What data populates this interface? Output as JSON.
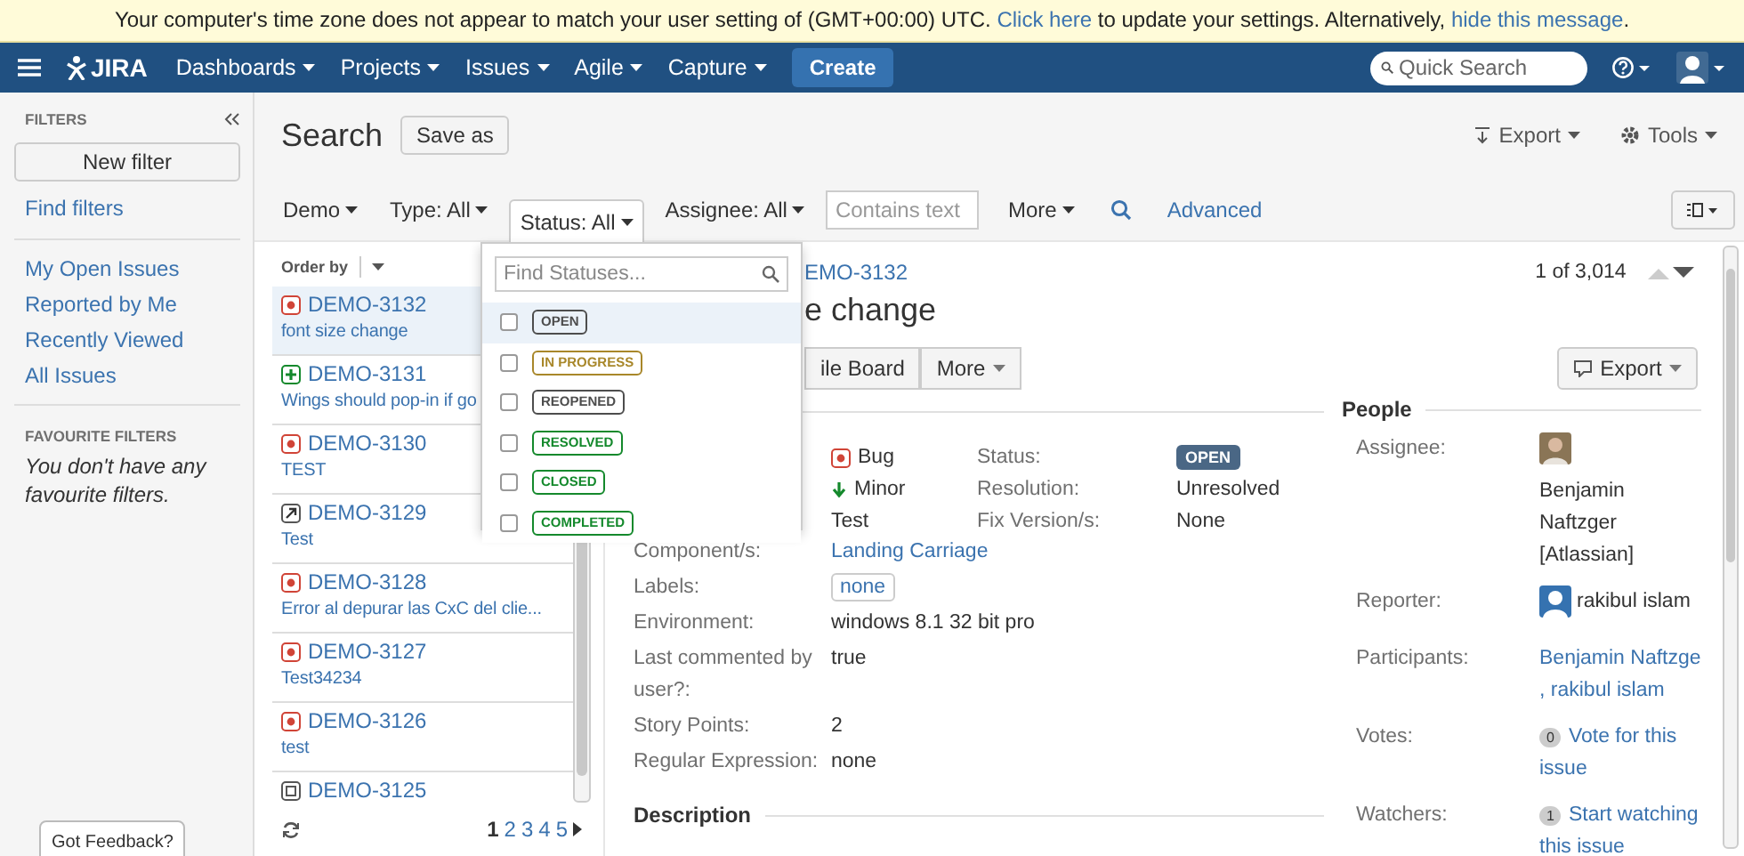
{
  "banner": {
    "parts": [
      {
        "kind": "text",
        "text": "Your computer's time zone does not appear to match your user setting of (GMT+00:00) UTC. "
      },
      {
        "kind": "link",
        "text": "Click here"
      },
      {
        "kind": "text",
        "text": " to update your settings. Alternatively, "
      },
      {
        "kind": "link",
        "text": "hide this message"
      },
      {
        "kind": "text",
        "text": "."
      }
    ]
  },
  "nav": {
    "logo": "JIRA",
    "menus": [
      "Dashboards",
      "Projects",
      "Issues",
      "Agile",
      "Capture"
    ],
    "create": "Create",
    "search_placeholder": "Quick Search"
  },
  "sidebar": {
    "title": "FILTERS",
    "new_filter": "New filter",
    "find_filters": "Find filters",
    "links": [
      "My Open Issues",
      "Reported by Me",
      "Recently Viewed",
      "All Issues"
    ],
    "favourites_title": "FAVOURITE FILTERS",
    "favourites_empty": "You don't have any favourite filters.",
    "feedback": "Got Feedback?"
  },
  "header": {
    "title": "Search",
    "save_as": "Save as",
    "export": "Export",
    "tools": "Tools"
  },
  "filters": [
    {
      "label": "Demo",
      "selected": false
    },
    {
      "label": "Type: All",
      "selected": false
    },
    {
      "label": "Status: All",
      "selected": true
    },
    {
      "label": "Assignee: All",
      "selected": false
    }
  ],
  "text_search": {
    "placeholder": "Contains text"
  },
  "more": "More",
  "advanced": "Advanced",
  "order_by": "Order by",
  "issues": [
    {
      "kind": "bug",
      "key": "DEMO-3132",
      "summary": "font size change",
      "selected": true
    },
    {
      "kind": "new-feature",
      "key": "DEMO-3131",
      "summary": "Wings should pop-in if go",
      "selected": false
    },
    {
      "kind": "bug",
      "key": "DEMO-3130",
      "summary": "TEST",
      "selected": false
    },
    {
      "kind": "improvement",
      "key": "DEMO-3129",
      "summary": "Test",
      "selected": false
    },
    {
      "kind": "bug",
      "key": "DEMO-3128",
      "summary": "Error al depurar las CxC del clie...",
      "selected": false
    },
    {
      "kind": "bug",
      "key": "DEMO-3127",
      "summary": "Test34234",
      "selected": false
    },
    {
      "kind": "bug",
      "key": "DEMO-3126",
      "summary": "test",
      "selected": false
    },
    {
      "kind": "other",
      "key": "DEMO-3125",
      "selected": false
    }
  ],
  "pages": [
    {
      "label": "1",
      "selected": true
    },
    {
      "label": "2",
      "selected": false
    },
    {
      "label": "3",
      "selected": false
    },
    {
      "label": "4",
      "selected": false
    },
    {
      "label": "5",
      "selected": false
    }
  ],
  "status_dropdown": {
    "placeholder": "Find Statuses...",
    "options": [
      {
        "label": "OPEN",
        "color": "#4d4d4d",
        "checked": false,
        "focused": true
      },
      {
        "label": "IN PROGRESS",
        "color": "#a8872a",
        "checked": false,
        "focused": false
      },
      {
        "label": "REOPENED",
        "color": "#4d4d4d",
        "checked": false,
        "focused": false
      },
      {
        "label": "RESOLVED",
        "color": "#14892c",
        "checked": false,
        "focused": false
      },
      {
        "label": "CLOSED",
        "color": "#14892c",
        "checked": false,
        "focused": false
      },
      {
        "label": "COMPLETED",
        "color": "#14892c",
        "checked": false,
        "focused": false
      }
    ]
  },
  "detail": {
    "key": "EMO-3132",
    "title": "e change",
    "buttons": [
      "ile Board",
      "More"
    ],
    "export": "Export",
    "pager": "1 of 3,014",
    "summary_fields": [
      {
        "kind": "bug",
        "value": "Bug"
      },
      {
        "kind": "minor",
        "value": "Minor"
      },
      {
        "kind": "plain",
        "value": "Test"
      }
    ],
    "status_fields": [
      {
        "label": "Status:",
        "value": "OPEN",
        "kind": "lozenge"
      },
      {
        "label": "Resolution:",
        "value": "Unresolved",
        "kind": "text"
      },
      {
        "label": "Fix Version/s:",
        "value": "None",
        "kind": "text"
      }
    ],
    "fields": [
      {
        "label": "Component/s:",
        "value": "Landing Carriage",
        "kind": "link"
      },
      {
        "label": "Labels:",
        "value": "none",
        "kind": "label"
      },
      {
        "label": "Environment:",
        "value": "windows 8.1 32 bit pro",
        "kind": "text"
      },
      {
        "label": "Last commented by user?:",
        "value": "true",
        "kind": "text"
      },
      {
        "label": "Story Points:",
        "value": "2",
        "kind": "text"
      },
      {
        "label": "Regular Expression:",
        "value": "none",
        "kind": "text"
      }
    ],
    "description_title": "Description"
  },
  "people": {
    "title": "People",
    "rows": [
      {
        "label": "Assignee:",
        "kind": "photo",
        "value": "Benjamin Naftzger [Atlassian]"
      },
      {
        "label": "Reporter:",
        "kind": "avatar",
        "value": "rakibul islam"
      },
      {
        "label": "Participants:",
        "kind": "links",
        "links": [
          "Benjamin Naftzge",
          ", rakibul islam"
        ]
      },
      {
        "label": "Votes:",
        "kind": "count",
        "count": "0",
        "value": "Vote for this issue"
      },
      {
        "label": "Watchers:",
        "kind": "count",
        "count": "1",
        "value": "Start watching this issue"
      }
    ]
  }
}
